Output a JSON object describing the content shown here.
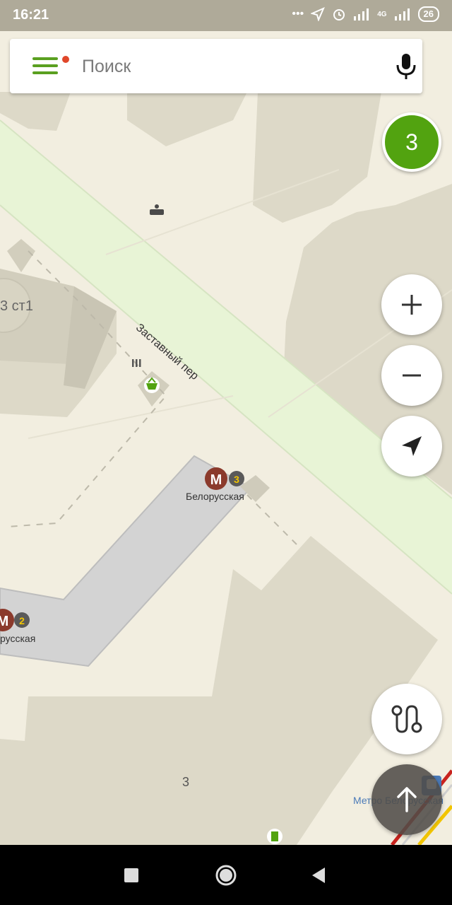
{
  "status_bar": {
    "time": "16:21",
    "battery": "26",
    "network": "4G"
  },
  "search": {
    "placeholder": "Поиск",
    "menu_icon": "hamburger-menu-icon",
    "mic_icon": "microphone-icon",
    "notification_dot_color": "#e0472a"
  },
  "layers_badge": {
    "value": "3",
    "color": "#52a310"
  },
  "map": {
    "street_label": "Заставный пер",
    "building_label": "3 ст1",
    "house_number": "3",
    "metro_station_1": {
      "name": "Белорусская",
      "line": "3"
    },
    "metro_station_2": {
      "name": "русская",
      "line": "2"
    },
    "transit_stop": "Метро Белорусская",
    "colors": {
      "ground": "#f2eee0",
      "green_strip": "#e8f4d6",
      "building": "#ddd9c8",
      "metro_building": "#d3d3d3",
      "metro_marker": "#8b3a2c"
    }
  },
  "controls": {
    "zoom_in_icon": "plus-icon",
    "zoom_out_icon": "minus-icon",
    "locate_icon": "navigation-arrow-icon",
    "route_icon": "route-icon",
    "navigate_icon": "up-arrow-icon"
  },
  "system_nav": {
    "recent_icon": "square-icon",
    "home_icon": "circle-icon",
    "back_icon": "triangle-back-icon"
  }
}
